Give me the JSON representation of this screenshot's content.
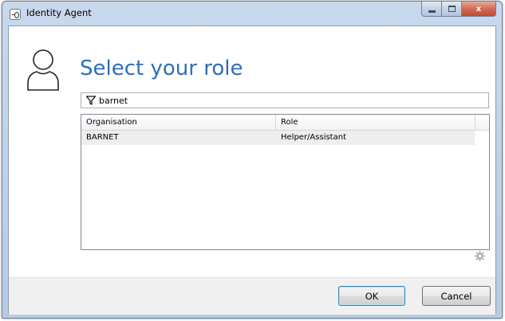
{
  "window": {
    "title": "Identity Agent",
    "close_glyph": "x"
  },
  "page": {
    "title": "Select your role"
  },
  "filter": {
    "value": "barnet",
    "icon": "filter-funnel-icon"
  },
  "grid": {
    "columns": [
      "Organisation",
      "Role"
    ],
    "rows": [
      {
        "organisation": "BARNET",
        "role": "Helper/Assistant"
      }
    ]
  },
  "footer": {
    "ok_label": "OK",
    "cancel_label": "Cancel"
  },
  "colors": {
    "title_blue": "#2f6fb6",
    "selected_row": "#eeeeee",
    "close_button": "#c14a33"
  }
}
